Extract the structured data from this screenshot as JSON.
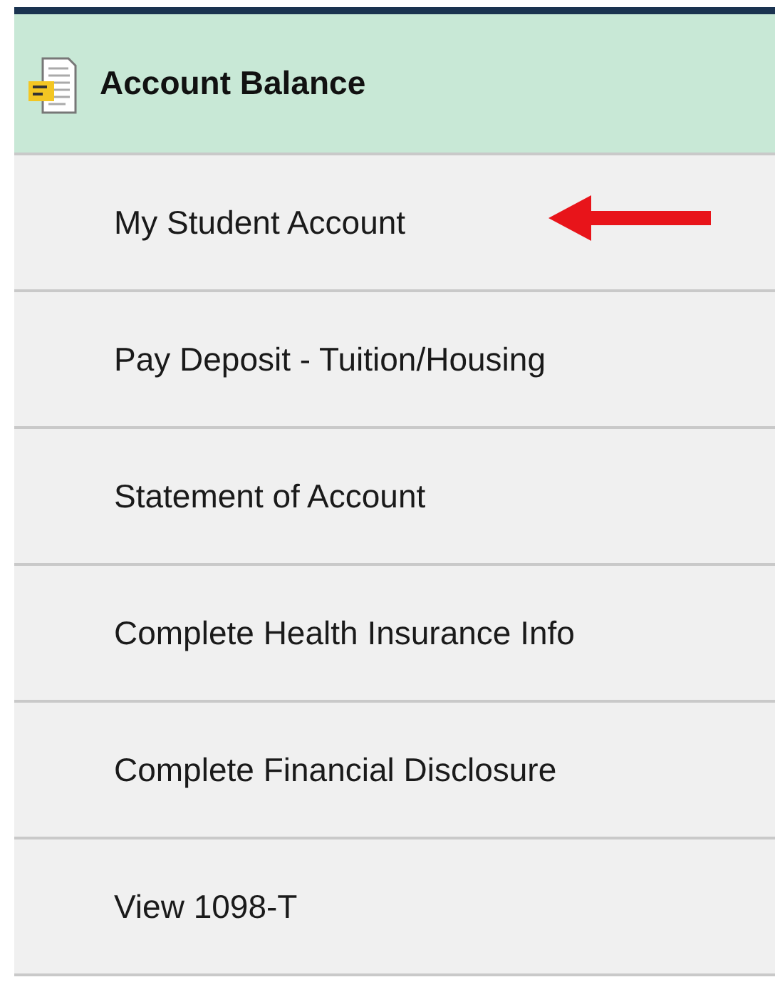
{
  "header": {
    "title": "Account Balance"
  },
  "items": [
    {
      "label": "My Student Account",
      "marked": true
    },
    {
      "label": "Pay Deposit - Tuition/Housing",
      "marked": false
    },
    {
      "label": "Statement of Account",
      "marked": false
    },
    {
      "label": "Complete Health Insurance Info",
      "marked": false
    },
    {
      "label": "Complete Financial Disclosure",
      "marked": false
    },
    {
      "label": "View 1098-T",
      "marked": false
    }
  ]
}
